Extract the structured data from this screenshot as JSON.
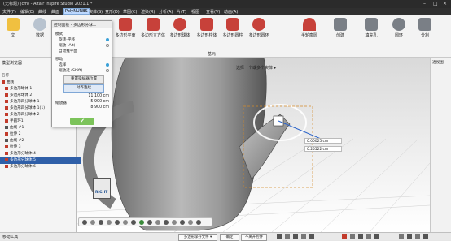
{
  "window": {
    "title": "(无标题) (cm) - Altair Inspire Studio 2021.1 *"
  },
  "menubar": [
    {
      "label": "文件(F)"
    },
    {
      "label": "编辑(E)"
    },
    {
      "label": "曲线"
    },
    {
      "label": "曲面"
    },
    {
      "label": "PolyNURBS",
      "active": true
    },
    {
      "label": "实体(S)"
    },
    {
      "label": "变形(D)"
    },
    {
      "label": "草图(C)"
    },
    {
      "label": "渲染(R)"
    },
    {
      "label": "分析(A)"
    },
    {
      "label": "片(T)"
    },
    {
      "label": "视图"
    },
    {
      "label": "查看(V)"
    },
    {
      "label": "动画(A)"
    }
  ],
  "ribbon": {
    "items": [
      {
        "label": "文"
      },
      {
        "label": "数据"
      },
      {
        "label": "多边形平面"
      },
      {
        "label": "多边形立方体"
      },
      {
        "label": "多边形球体"
      },
      {
        "label": "多边形柱体"
      },
      {
        "label": "多边形圆柱"
      },
      {
        "label": "多边形圆环"
      },
      {
        "label": "半轮廓圆"
      },
      {
        "label": "创建"
      },
      {
        "label": "填充孔"
      },
      {
        "label": "圆环"
      },
      {
        "label": "分割"
      }
    ],
    "group_label": "基元"
  },
  "dialog": {
    "title": "控制面板 - 多边形分球...",
    "mode_heading": "模式",
    "modes": [
      {
        "label": "旋转-平移"
      },
      {
        "label": "缩放 (Alt)"
      },
      {
        "label": "自动推平面"
      }
    ],
    "move_heading": "移动",
    "move_options": [
      {
        "label": "选择"
      },
      {
        "label": "缩放选 (Shift)"
      }
    ],
    "reset_button": "重置操纵器位置",
    "apply_button": "对齐连续",
    "scale_label": "缩放器",
    "values": [
      "11.100 cm",
      "5.900 cm",
      "8.900 cm"
    ]
  },
  "browser": {
    "title": "模型浏览器",
    "name_header": "名称",
    "items": [
      {
        "label": "曲线"
      },
      {
        "label": "多边形球体 1"
      },
      {
        "label": "多边形球体 2"
      },
      {
        "label": "多边形四分球体 1"
      },
      {
        "label": "多边形四分球体 1(1)"
      },
      {
        "label": "多边形四分球体 2"
      },
      {
        "label": "半圆环1"
      },
      {
        "label": "曲线 #1"
      },
      {
        "label": "拉伸 2"
      },
      {
        "label": "曲线 #2"
      },
      {
        "label": "拉伸 3"
      },
      {
        "label": "多边形分球体 4"
      },
      {
        "label": "多边形分球体 5",
        "selected": true
      },
      {
        "label": "多边形分球体 6"
      }
    ]
  },
  "viewport": {
    "hint": "选择一个或多个实体 ▸",
    "cube_label": "RIGHT",
    "coord_values": [
      "0.00025 cm",
      "0.25522 cm"
    ]
  },
  "rightstrip": {
    "label": "透视图"
  },
  "statusbar": {
    "left": "移动工具",
    "buttons": [
      "多边形保存文件 ▾",
      "确定",
      "不离开控件"
    ]
  }
}
